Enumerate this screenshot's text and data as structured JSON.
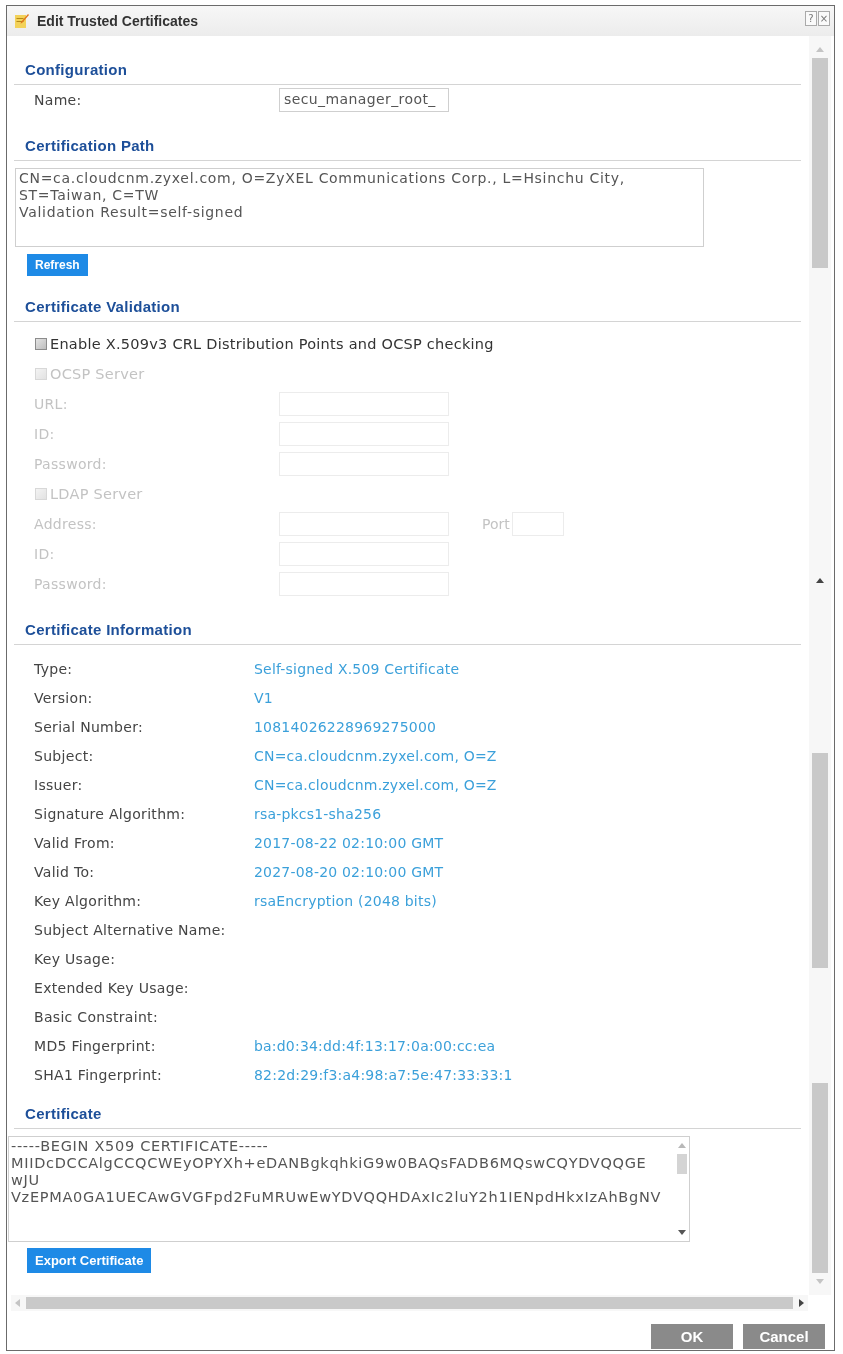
{
  "window": {
    "title": "Edit Trusted Certificates",
    "help_button": "?",
    "close_button": "×"
  },
  "configuration": {
    "heading": "Configuration",
    "fields": [
      {
        "label": "Name:",
        "value": "secu_manager_root_"
      }
    ]
  },
  "certification_path": {
    "heading": "Certification Path",
    "lines": [
      "CN=ca.cloudcnm.zyxel.com, O=ZyXEL Communications Corp., L=Hsinchu City,",
      "ST=Taiwan, C=TW",
      "Validation Result=self-signed"
    ],
    "refresh_button": "Refresh"
  },
  "certificate_validation": {
    "heading": "Certificate Validation",
    "items": [
      {
        "kind": "checkbox",
        "label": "Enable X.509v3 CRL Distribution Points and OCSP checking",
        "checked": false,
        "disabled": false
      },
      {
        "kind": "checkbox",
        "label": "OCSP Server",
        "checked": false,
        "disabled": true
      },
      {
        "kind": "field",
        "label": "URL:",
        "disabled": true
      },
      {
        "kind": "field",
        "label": "ID:",
        "disabled": true
      },
      {
        "kind": "field",
        "label": "Password:",
        "disabled": true
      },
      {
        "kind": "checkbox",
        "label": "LDAP Server",
        "checked": false,
        "disabled": true
      },
      {
        "kind": "field",
        "label": "Address:",
        "disabled": true,
        "port": {
          "label": "Port"
        }
      },
      {
        "kind": "field",
        "label": "ID:",
        "disabled": true
      },
      {
        "kind": "field",
        "label": "Password:",
        "disabled": true
      }
    ]
  },
  "certificate_information": {
    "heading": "Certificate Information",
    "rows": [
      {
        "label": "Type:",
        "value": "Self-signed X.509 Certificate"
      },
      {
        "label": "Version:",
        "value": "V1"
      },
      {
        "label": "Serial Number:",
        "value": "10814026228969275000"
      },
      {
        "label": "Subject:",
        "value": "CN=ca.cloudcnm.zyxel.com, O=Z"
      },
      {
        "label": "Issuer:",
        "value": "CN=ca.cloudcnm.zyxel.com, O=Z"
      },
      {
        "label": "Signature Algorithm:",
        "value": "rsa-pkcs1-sha256"
      },
      {
        "label": "Valid From:",
        "value": "2017-08-22 02:10:00 GMT"
      },
      {
        "label": "Valid To:",
        "value": "2027-08-20 02:10:00 GMT"
      },
      {
        "label": "Key Algorithm:",
        "value": "rsaEncryption (2048 bits)"
      },
      {
        "label": "Subject Alternative Name:"
      },
      {
        "label": "Key Usage:"
      },
      {
        "label": "Extended Key Usage:"
      },
      {
        "label": "Basic Constraint:"
      },
      {
        "label": "MD5 Fingerprint:",
        "value": "ba:d0:34:dd:4f:13:17:0a:00:cc:ea"
      },
      {
        "label": "SHA1 Fingerprint:",
        "value": "82:2d:29:f3:a4:98:a7:5e:47:33:33:1"
      }
    ]
  },
  "certificate": {
    "heading": "Certificate",
    "lines": [
      "-----BEGIN X509 CERTIFICATE-----",
      "MIIDcDCCAlgCCQCWEyOPYXh+eDANBgkqhkiG9w0BAQsFADB6MQswCQYDVQQGE",
      "wJU",
      "VzEPMA0GA1UECAwGVGFpd2FuMRUwEwYDVQQHDAxIc2luY2h1IENpdHkxIzAhBgNV"
    ],
    "export_button": "Export Certificate"
  },
  "footer": {
    "buttons": [
      "OK",
      "Cancel"
    ]
  }
}
